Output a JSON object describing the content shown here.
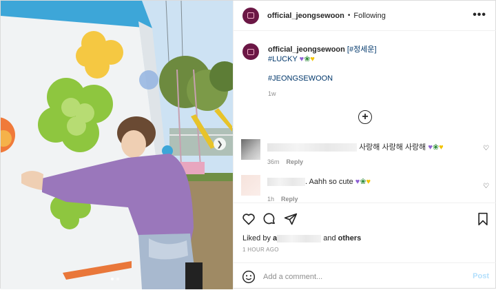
{
  "post": {
    "username": "official_jeongsewoon",
    "separator": "•",
    "following": "Following",
    "more": "•••"
  },
  "caption": {
    "username": "official_jeongsewoon",
    "tag_name": "[#정세운]",
    "tag_lucky": "#LUCKY",
    "tag_hashtag": "#JEONGSEWOON",
    "time": "1w",
    "emojis": [
      "heart-purple",
      "four-leaf-clover",
      "heart-yellow"
    ]
  },
  "comments": [
    {
      "text": "사랑해 사랑해 사랑해",
      "time": "36m",
      "reply": "Reply",
      "emojis": [
        "heart-purple",
        "four-leaf-clover",
        "heart-yellow"
      ]
    },
    {
      "text": ". Aahh so cute",
      "time": "1h",
      "reply": "Reply",
      "emojis": [
        "heart-purple",
        "four-leaf-clover",
        "heart-yellow"
      ]
    }
  ],
  "likes": {
    "prefix": "Liked by",
    "visible_start": "a",
    "joiner": "and",
    "others": "others"
  },
  "posted_ago": "1 HOUR AGO",
  "add_comment": {
    "placeholder": "Add a comment...",
    "post_label": "Post"
  },
  "colors": {
    "link": "#00376b",
    "muted": "#8e8e8e",
    "post_disabled": "#b2dffc",
    "avatar_bg": "#6b1745"
  },
  "icons": [
    "heart-icon",
    "comment-icon",
    "share-icon",
    "bookmark-icon",
    "emoji-icon",
    "plus-circle-icon",
    "more-icon",
    "chevron-right-icon"
  ]
}
